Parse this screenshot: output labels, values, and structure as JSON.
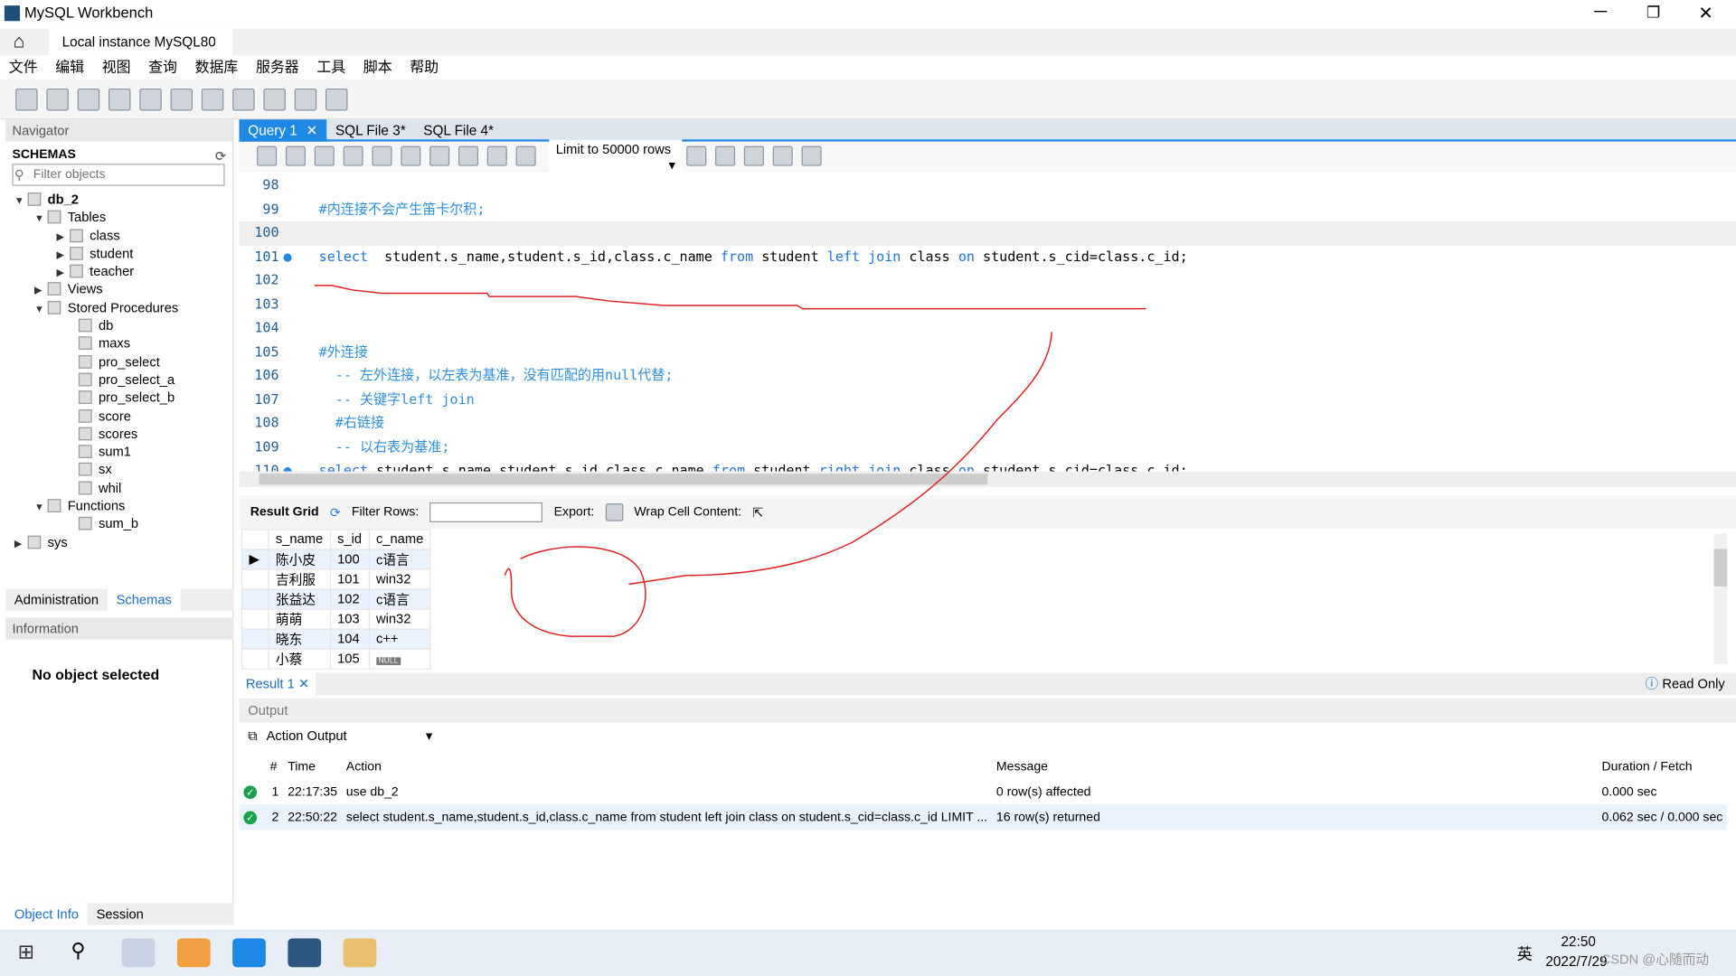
{
  "window": {
    "title": "MySQL Workbench",
    "tab": "Local instance MySQL80"
  },
  "menu": [
    "文件",
    "编辑",
    "视图",
    "查询",
    "数据库",
    "服务器",
    "工具",
    "脚本",
    "帮助"
  ],
  "navigator": {
    "title": "Navigator",
    "schemas_label": "SCHEMAS",
    "filter_placeholder": "Filter objects",
    "db": "db_2",
    "tables_label": "Tables",
    "tables": [
      "class",
      "student",
      "teacher"
    ],
    "views_label": "Views",
    "procs_label": "Stored Procedures",
    "procs": [
      "db",
      "maxs",
      "pro_select",
      "pro_select_a",
      "pro_select_b",
      "score",
      "scores",
      "sum1",
      "sx",
      "whil"
    ],
    "functions_label": "Functions",
    "functions": [
      "sum_b"
    ],
    "sys": "sys",
    "tabs": [
      "Administration",
      "Schemas"
    ],
    "info_label": "Information",
    "no_object": "No object selected",
    "bottom_tabs": [
      "Object Info",
      "Session"
    ]
  },
  "query_tabs": [
    "Query 1",
    "SQL File 3*",
    "SQL File 4*"
  ],
  "limit_select": "Limit to 50000 rows",
  "editor": [
    {
      "n": "98",
      "parts": []
    },
    {
      "n": "99",
      "parts": [
        [
          "cm",
          "#内连接不会产生笛卡尔积;"
        ]
      ]
    },
    {
      "n": "100",
      "parts": []
    },
    {
      "n": "101",
      "dot": true,
      "parts": [
        [
          "kw",
          "select"
        ],
        [
          "",
          "  student.s_name,student.s_id,class.c_name "
        ],
        [
          "kw",
          "from"
        ],
        [
          "",
          " student "
        ],
        [
          "kw",
          "left join"
        ],
        [
          "",
          " class "
        ],
        [
          "kw",
          "on"
        ],
        [
          "",
          " student.s_cid=class.c_id;"
        ]
      ]
    },
    {
      "n": "102",
      "parts": []
    },
    {
      "n": "103",
      "parts": []
    },
    {
      "n": "104",
      "parts": []
    },
    {
      "n": "105",
      "parts": [
        [
          "cm",
          "#外连接"
        ]
      ]
    },
    {
      "n": "106",
      "parts": [
        [
          "cm",
          "  -- 左外连接，以左表为基准，没有匹配的用null代替;"
        ]
      ]
    },
    {
      "n": "107",
      "parts": [
        [
          "cm",
          "  -- 关键字left join"
        ]
      ]
    },
    {
      "n": "108",
      "parts": [
        [
          "cm",
          "  #右链接"
        ]
      ]
    },
    {
      "n": "109",
      "parts": [
        [
          "cm",
          "  -- 以右表为基准;"
        ]
      ]
    },
    {
      "n": "110",
      "dot": true,
      "parts": [
        [
          "kw",
          "select"
        ],
        [
          "",
          " student.s_name,student.s_id,class.c_name "
        ],
        [
          "kw",
          "from"
        ],
        [
          "",
          " student "
        ],
        [
          "kw",
          "right join"
        ],
        [
          "",
          " class "
        ],
        [
          "kw",
          "on"
        ],
        [
          "",
          " student.s_cid=class.c_id;"
        ]
      ]
    }
  ],
  "result": {
    "grid_label": "Result Grid",
    "filter_label": "Filter Rows:",
    "export_label": "Export:",
    "wrap_label": "Wrap Cell Content:",
    "columns": [
      "s_name",
      "s_id",
      "c_name"
    ],
    "rows": [
      [
        "陈小皮",
        "100",
        "c语言"
      ],
      [
        "吉利服",
        "101",
        "win32"
      ],
      [
        "张益达",
        "102",
        "c语言"
      ],
      [
        "萌萌",
        "103",
        "win32"
      ],
      [
        "晓东",
        "104",
        "c++"
      ],
      [
        "小蔡",
        "105",
        "NULL"
      ]
    ],
    "tab": "Result 1",
    "read_only": "Read Only"
  },
  "output": {
    "label": "Output",
    "select": "Action Output",
    "columns": [
      "#",
      "Time",
      "Action",
      "Message",
      "Duration / Fetch"
    ],
    "rows": [
      [
        "1",
        "22:17:35",
        "use db_2",
        "0 row(s) affected",
        "0.000 sec"
      ],
      [
        "2",
        "22:50:22",
        "select student.s_name,student.s_id,class.c_name from student left join class on student.s_cid=class.c_id LIMIT ...",
        "16 row(s) returned",
        "0.062 sec / 0.000 sec"
      ]
    ]
  },
  "taskbar": {
    "time": "22:50",
    "date": "2022/7/29",
    "ime": "英",
    "watermark": "CSDN @心随而动"
  }
}
